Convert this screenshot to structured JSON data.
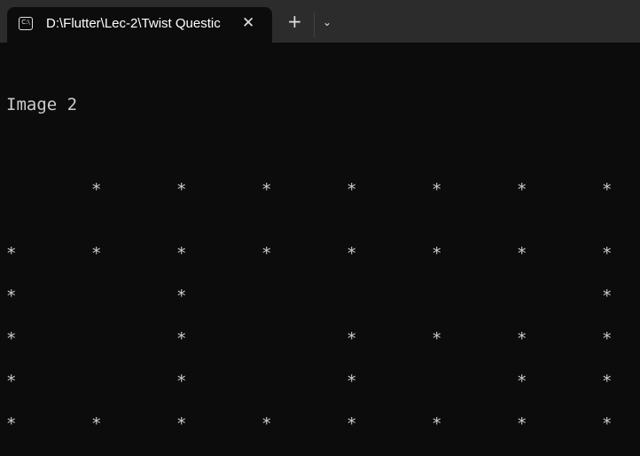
{
  "window": {
    "tab_title": "D:\\Flutter\\Lec-2\\Twist Questic",
    "tab_icon": "cmd-icon",
    "tab_icon_text": "C:\\",
    "close_label": "✕",
    "new_tab_label": "+",
    "dropdown_label": "⌄"
  },
  "console": {
    "heading": "Image 2",
    "rows": [
      [
        "",
        "*",
        "*",
        "*",
        "*",
        "*",
        "*",
        "*"
      ],
      [
        "*",
        "*",
        "*",
        "*",
        "*",
        "*",
        "*",
        "*"
      ],
      [
        "*",
        "",
        "*",
        "",
        "",
        "",
        "",
        "*"
      ],
      [
        "*",
        "",
        "*",
        "",
        "*",
        "*",
        "*",
        "*"
      ],
      [
        "*",
        "",
        "*",
        "",
        "*",
        "",
        "*",
        "*"
      ],
      [
        "*",
        "*",
        "*",
        "*",
        "*",
        "*",
        "*",
        "*"
      ]
    ]
  }
}
